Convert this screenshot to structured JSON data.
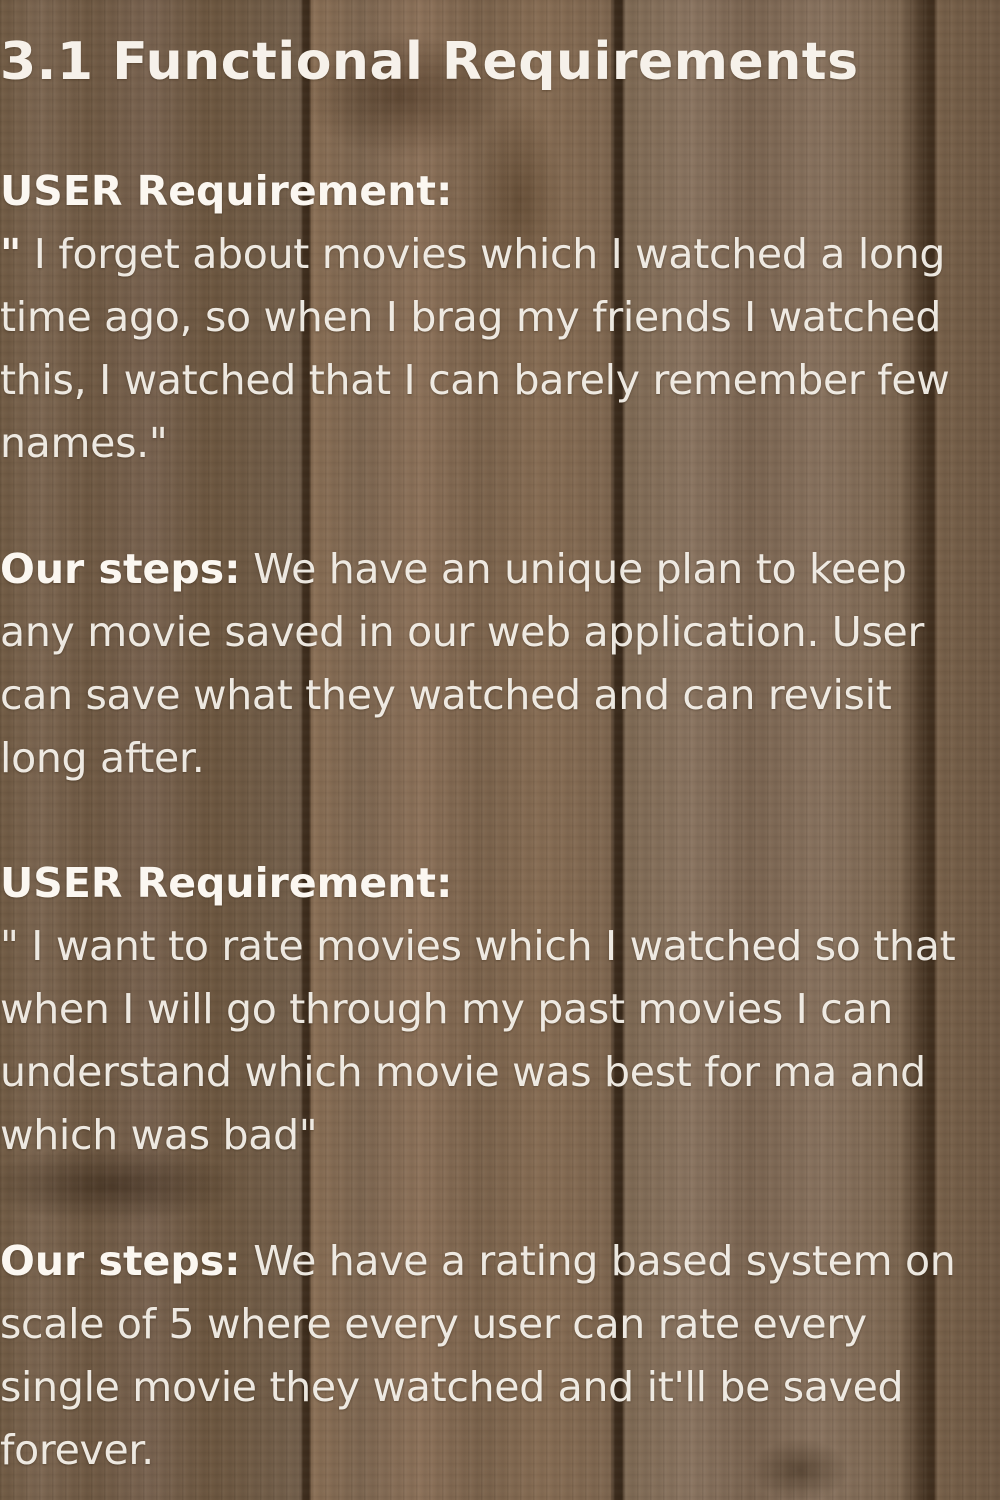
{
  "title": "3.1 Functional Requirements",
  "sections": [
    {
      "heading": "USER Requirement:",
      "quote_mark": "\"",
      "text": " I forget about movies which I watched a long time ago, so when I brag my friends I watched this, I watched that I can barely remember few names.\""
    },
    {
      "label": "Our steps:",
      "text": " We have an unique plan to keep any movie saved in our web application. User can save what they watched and can revisit long after."
    },
    {
      "heading": "USER Requirement:",
      "text": "\" I want to rate movies which I watched so that when I will go through my past movies I can understand which movie was best for ma and which was bad\""
    },
    {
      "label": "Our steps:",
      "text": " We have a rating based system on scale of 5 where every user can rate every single movie they watched and it'll be saved forever."
    }
  ]
}
